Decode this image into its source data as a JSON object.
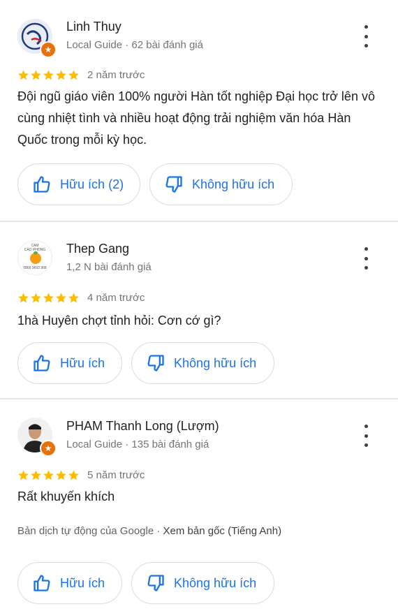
{
  "reviews": [
    {
      "name": "Linh Thuy",
      "meta": "Local Guide · 62 bài đánh giá",
      "date": "2 năm trước",
      "text": "Đội ngũ giáo viên 100% người Hàn tốt nghiệp Đại học trở lên vô cùng nhiệt tình và nhiều hoạt động trải nghiệm văn hóa Hàn Quốc trong mỗi kỳ học.",
      "helpful_label": "Hữu ích (2)",
      "not_helpful_label": "Không hữu ích",
      "rating": 5
    },
    {
      "name": "Thep Gang",
      "meta": "1,2 N bài đánh giá",
      "date": "4 năm trước",
      "text": "1hà Huyên chợt tỉnh hỏi: Cơn cớ gì?",
      "helpful_label": "Hữu ích",
      "not_helpful_label": "Không hữu ích",
      "rating": 5,
      "avatar_text_top": "CAM",
      "avatar_text_mid": "CAO PHONG",
      "avatar_text_bottom": "0866 9693 968"
    },
    {
      "name": "PHAM Thanh Long (Lượm)",
      "meta": "Local Guide · 135 bài đánh giá",
      "date": "5 năm trước",
      "text": "Rất khuyến khích",
      "translation_note": "Bản dịch tự động của Google",
      "translation_link": "Xem bản gốc (Tiếng Anh)",
      "helpful_label": "Hữu ích",
      "not_helpful_label": "Không hữu ích",
      "rating": 5
    }
  ],
  "colors": {
    "star": "#fbbc04",
    "button_text": "#1a73e8",
    "badge": "#e8710a",
    "secondary_text": "#70757a"
  },
  "icons": [
    "thumbs-up-icon",
    "thumbs-down-icon",
    "more-vert-icon",
    "star-icon",
    "local-guide-badge-icon"
  ]
}
